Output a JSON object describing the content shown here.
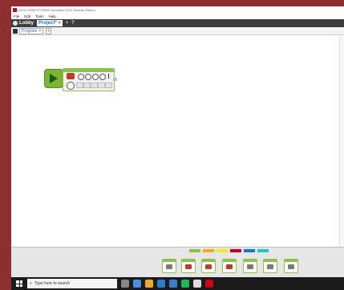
{
  "window": {
    "title": "LEGO MINDSTORMS Education EV3 Teacher Edition"
  },
  "menu": {
    "items": [
      "File",
      "Edit",
      "Tools",
      "Help"
    ]
  },
  "tabs": {
    "lobby": "Lobby",
    "project": "Project*",
    "close": "×",
    "add": "+",
    "help": "?"
  },
  "program": {
    "tab_label": "Program",
    "close": "×",
    "add": "+"
  },
  "taskbar": {
    "search_placeholder": "Type here to search"
  },
  "colors": {
    "accent_blue": "#1a6fbf",
    "palette_green": "#8bc34a",
    "palette_orange": "#f5a623",
    "palette_yellow": "#f8e71c",
    "palette_red": "#d0021b",
    "palette_blue": "#1976d2",
    "palette_teal": "#1ec6d0"
  },
  "icons": [
    "app-icon",
    "home-icon",
    "wrench-icon",
    "start-icon",
    "search-icon",
    "play-icon",
    "motor-icon"
  ]
}
